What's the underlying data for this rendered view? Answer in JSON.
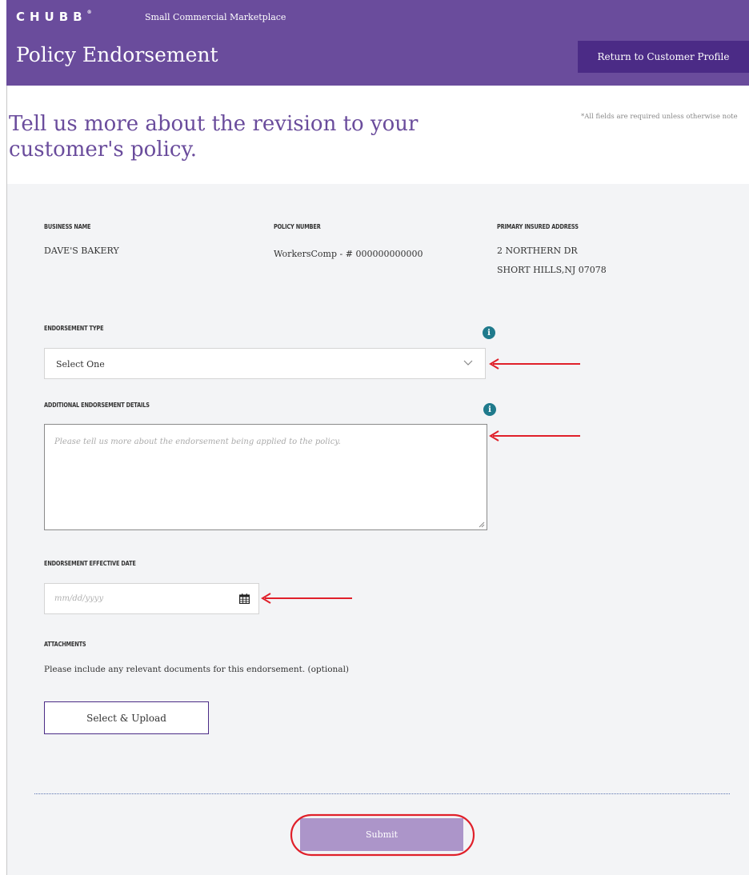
{
  "header": {
    "logo_text": "CHUBB",
    "logo_mark": "®",
    "app_name": "Small Commercial Marketplace",
    "page_title": "Policy Endorsement",
    "return_button_label": "Return to Customer Profile"
  },
  "intro": {
    "headline": "Tell us more about the revision to your customer's policy.",
    "required_note": "*All fields are required unless otherwise note"
  },
  "summary": {
    "business_name_label": "BUSINESS NAME",
    "business_name_value": "DAVE'S BAKERY",
    "policy_number_label": "POLICY NUMBER",
    "policy_number_value": "WorkersComp - # 000000000000",
    "address_label": "PRIMARY INSURED ADDRESS",
    "address_line1": "2 NORTHERN DR",
    "address_line2": "SHORT HILLS,NJ 07078"
  },
  "form": {
    "endorsement_type_label": "ENDORSEMENT TYPE",
    "endorsement_type_value": "Select One",
    "details_label": "ADDITIONAL ENDORSEMENT DETAILS",
    "details_placeholder": "Please tell us more about the endorsement being applied to the policy.",
    "effective_date_label": "ENDORSEMENT EFFECTIVE DATE",
    "effective_date_placeholder": "mm/dd/yyyy",
    "attachments_label": "ATTACHMENTS",
    "attachments_help": "Please include any relevant documents for this endorsement. (optional)",
    "upload_button_label": "Select & Upload",
    "submit_button_label": "Submit",
    "info_icon_glyph": "i"
  },
  "icons": {
    "info": "info-icon",
    "dropdown": "chevron-down-icon",
    "calendar": "calendar-icon",
    "resize": "resize-handle-icon"
  },
  "colors": {
    "header_bg": "#6a4c9c",
    "button_dark": "#4b2b86",
    "headline": "#6a4c9c",
    "info_icon": "#1f7a8c",
    "submit_bg": "#ac95c9",
    "annotation_red": "#e0202a",
    "panel_bg": "#f3f4f6"
  }
}
